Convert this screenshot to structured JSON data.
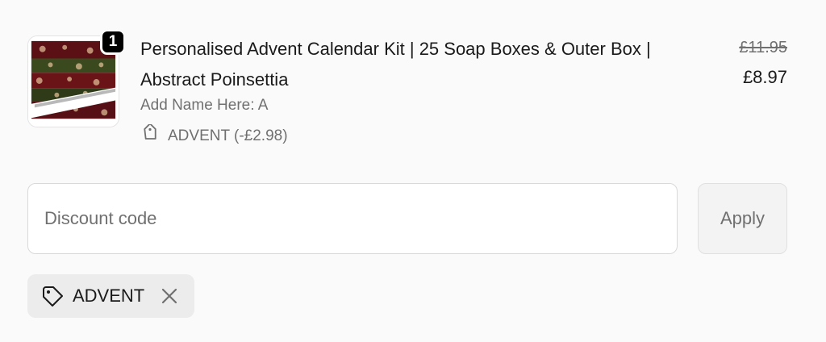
{
  "line_item": {
    "quantity": "1",
    "title_line1": "Personalised Advent Calendar Kit | 25 Soap Boxes & Outer Box |",
    "title_line2": "Abstract Poinsettia",
    "variant": "Add Name Here: A",
    "discount_applied": "ADVENT (-£2.98)",
    "price_original": "£11.95",
    "price_current": "£8.97",
    "image_icon": "product-image"
  },
  "discount_form": {
    "placeholder": "Discount code",
    "value": "",
    "apply_label": "Apply"
  },
  "applied_codes": [
    {
      "code": "ADVENT",
      "icon": "tag-icon",
      "remove_icon": "close-icon"
    }
  ],
  "colors": {
    "background": "#fafafa",
    "badge": "#000000",
    "muted_text": "#707070",
    "chip_bg": "#ececec"
  }
}
